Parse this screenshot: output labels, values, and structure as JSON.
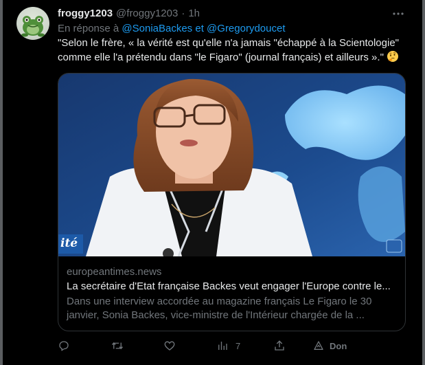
{
  "tweet": {
    "display_name": "froggy1203",
    "handle": "@froggy1203",
    "separator": "·",
    "time": "1h",
    "more_icon": "more-horizontal-icon",
    "reply_prefix": "En réponse à",
    "reply_mentions": [
      "@SoniaBackes",
      "et",
      "@Gregorydoucet"
    ],
    "text": "\"Selon le frère, « la vérité est qu'elle n'a jamais \"échappé à la Scientologie\" comme elle l'a prétendu dans \"le Figaro\" (journal français) et ailleurs ».\"",
    "emoji": "thinking-face"
  },
  "card": {
    "domain": "europeantimes.news",
    "title": "La secrétaire d'Etat française Backes veut engager l'Europe contre le...",
    "description": "Dans une interview accordée au magazine français Le Figaro le 30 janvier, Sonia Backes, vice-ministre de l'Intérieur chargée de la ...",
    "image_overlay_text": "ité"
  },
  "actions": {
    "reply": {
      "icon": "reply-icon",
      "count": ""
    },
    "retweet": {
      "icon": "retweet-icon",
      "count": ""
    },
    "like": {
      "icon": "heart-icon",
      "count": ""
    },
    "views": {
      "icon": "views-chart-icon",
      "count": "7"
    },
    "share": {
      "icon": "share-icon",
      "count": ""
    },
    "donate": {
      "icon": "donate-icon",
      "label": "Don"
    }
  },
  "colors": {
    "background": "#000000",
    "text_primary": "#e7e9ea",
    "text_secondary": "#71767b",
    "link": "#1d9bf0",
    "border": "#2f3336"
  }
}
